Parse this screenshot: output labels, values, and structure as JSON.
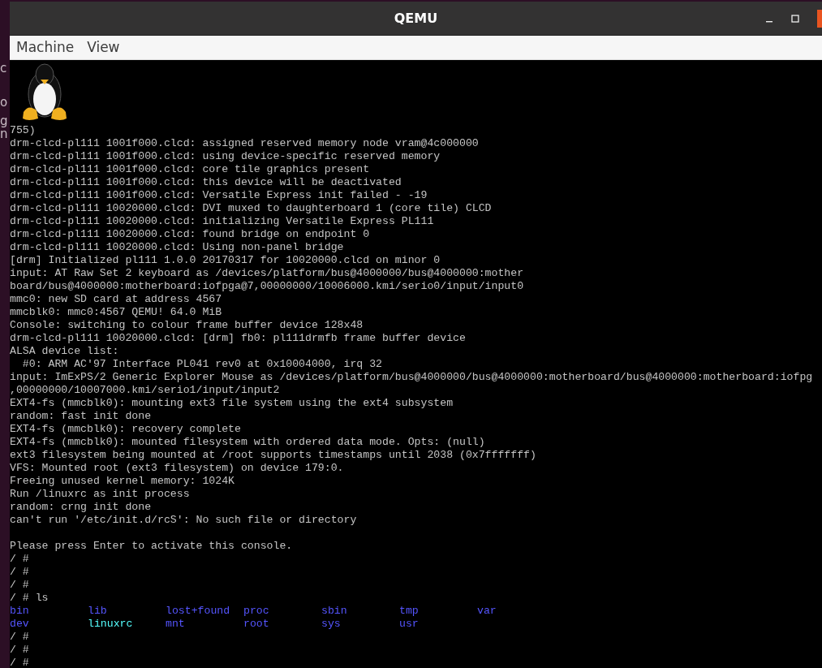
{
  "desktop": {
    "fragments": [
      "c",
      "o",
      "g",
      "n"
    ]
  },
  "window": {
    "title": "QEMU"
  },
  "menu": [
    "Machine",
    "View"
  ],
  "terminal": {
    "lines": [
      {
        "kind": "text",
        "text": "755)"
      },
      {
        "kind": "text",
        "text": "drm-clcd-pl111 1001f000.clcd: assigned reserved memory node vram@4c000000"
      },
      {
        "kind": "text",
        "text": "drm-clcd-pl111 1001f000.clcd: using device-specific reserved memory"
      },
      {
        "kind": "text",
        "text": "drm-clcd-pl111 1001f000.clcd: core tile graphics present"
      },
      {
        "kind": "text",
        "text": "drm-clcd-pl111 1001f000.clcd: this device will be deactivated"
      },
      {
        "kind": "text",
        "text": "drm-clcd-pl111 1001f000.clcd: Versatile Express init failed - -19"
      },
      {
        "kind": "text",
        "text": "drm-clcd-pl111 10020000.clcd: DVI muxed to daughterboard 1 (core tile) CLCD"
      },
      {
        "kind": "text",
        "text": "drm-clcd-pl111 10020000.clcd: initializing Versatile Express PL111"
      },
      {
        "kind": "text",
        "text": "drm-clcd-pl111 10020000.clcd: found bridge on endpoint 0"
      },
      {
        "kind": "text",
        "text": "drm-clcd-pl111 10020000.clcd: Using non-panel bridge"
      },
      {
        "kind": "text",
        "text": "[drm] Initialized pl111 1.0.0 20170317 for 10020000.clcd on minor 0"
      },
      {
        "kind": "text",
        "text": "input: AT Raw Set 2 keyboard as /devices/platform/bus@4000000/bus@4000000:mother"
      },
      {
        "kind": "text",
        "text": "board/bus@4000000:motherboard:iofpga@7,00000000/10006000.kmi/serio0/input/input0"
      },
      {
        "kind": "text",
        "text": "mmc0: new SD card at address 4567"
      },
      {
        "kind": "text",
        "text": "mmcblk0: mmc0:4567 QEMU! 64.0 MiB"
      },
      {
        "kind": "text",
        "text": "Console: switching to colour frame buffer device 128x48"
      },
      {
        "kind": "text",
        "text": "drm-clcd-pl111 10020000.clcd: [drm] fb0: pl111drmfb frame buffer device"
      },
      {
        "kind": "text",
        "text": "ALSA device list:"
      },
      {
        "kind": "text",
        "text": "  #0: ARM AC'97 Interface PL041 rev0 at 0x10004000, irq 32"
      },
      {
        "kind": "text",
        "text": "input: ImExPS/2 Generic Explorer Mouse as /devices/platform/bus@4000000/bus@4000000:motherboard/bus@4000000:motherboard:iofpg"
      },
      {
        "kind": "text",
        "text": ",00000000/10007000.kmi/serio1/input/input2"
      },
      {
        "kind": "text",
        "text": "EXT4-fs (mmcblk0): mounting ext3 file system using the ext4 subsystem"
      },
      {
        "kind": "text",
        "text": "random: fast init done"
      },
      {
        "kind": "text",
        "text": "EXT4-fs (mmcblk0): recovery complete"
      },
      {
        "kind": "text",
        "text": "EXT4-fs (mmcblk0): mounted filesystem with ordered data mode. Opts: (null)"
      },
      {
        "kind": "text",
        "text": "ext3 filesystem being mounted at /root supports timestamps until 2038 (0x7fffffff)"
      },
      {
        "kind": "text",
        "text": "VFS: Mounted root (ext3 filesystem) on device 179:0."
      },
      {
        "kind": "text",
        "text": "Freeing unused kernel memory: 1024K"
      },
      {
        "kind": "text",
        "text": "Run /linuxrc as init process"
      },
      {
        "kind": "text",
        "text": "random: crng init done"
      },
      {
        "kind": "text",
        "text": "can't run '/etc/init.d/rcS': No such file or directory"
      },
      {
        "kind": "blank"
      },
      {
        "kind": "text",
        "text": "Please press Enter to activate this console."
      },
      {
        "kind": "text",
        "text": "/ #"
      },
      {
        "kind": "text",
        "text": "/ #"
      },
      {
        "kind": "text",
        "text": "/ #"
      },
      {
        "kind": "text",
        "text": "/ # ls"
      },
      {
        "kind": "listing",
        "entries": [
          {
            "name": "bin",
            "color": "#5555ff"
          },
          {
            "name": "lib",
            "color": "#5555ff"
          },
          {
            "name": "lost+found",
            "color": "#5555ff"
          },
          {
            "name": "proc",
            "color": "#5555ff"
          },
          {
            "name": "sbin",
            "color": "#5555ff"
          },
          {
            "name": "tmp",
            "color": "#5555ff"
          },
          {
            "name": "var",
            "color": "#5555ff"
          }
        ]
      },
      {
        "kind": "listing",
        "entries": [
          {
            "name": "dev",
            "color": "#5555ff"
          },
          {
            "name": "linuxrc",
            "color": "#55ffff"
          },
          {
            "name": "mnt",
            "color": "#5555ff"
          },
          {
            "name": "root",
            "color": "#5555ff"
          },
          {
            "name": "sys",
            "color": "#5555ff"
          },
          {
            "name": "usr",
            "color": "#5555ff"
          }
        ]
      },
      {
        "kind": "text",
        "text": "/ #"
      },
      {
        "kind": "text",
        "text": "/ #"
      },
      {
        "kind": "text",
        "text": "/ #"
      }
    ]
  }
}
